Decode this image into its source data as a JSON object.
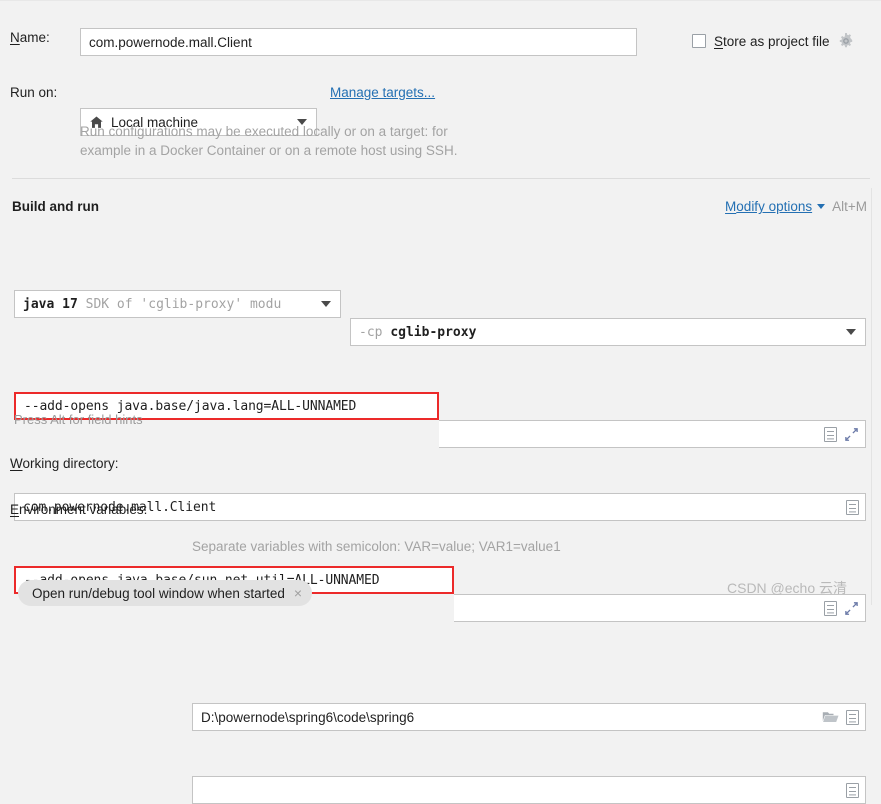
{
  "window": {
    "watermark": "CSDN @echo 云清"
  },
  "name_row": {
    "label": "Name:",
    "mnemonic": "N",
    "label_rest": "ame:",
    "value": "com.powernode.mall.Client",
    "store_as_project_file": {
      "label": "Store as project file",
      "mnemonic": "S",
      "label_rest": "tore as project file",
      "checked": false
    },
    "gear_icon": "gear-icon"
  },
  "run_on": {
    "label": "Run on:",
    "target": "Local machine",
    "target_icon": "home-icon",
    "manage_targets_link": "Manage targets...",
    "description_line1": "Run configurations may be executed locally or on a target: for",
    "description_line2": "example in a Docker Container or on a remote host using SSH."
  },
  "build_and_run": {
    "title": "Build and run",
    "modify_options": {
      "mnemonic": "M",
      "label_rest": "odify options",
      "full_label": "Modify options",
      "shortcut": "Alt+M"
    },
    "jre_combo": {
      "value_bold": "java 17",
      "value_dim": "SDK of 'cglib-proxy' modu"
    },
    "module_combo": {
      "prefix": "-cp",
      "value": "cglib-proxy"
    },
    "vm_options_field": {
      "value": "--add-opens java.base/java.lang=ALL-UNNAMED",
      "highlighted": true,
      "icons": [
        "document-icon",
        "expand-icon"
      ]
    },
    "main_class_field": {
      "value": "com.powernode.mall.Client",
      "icons": [
        "document-icon"
      ]
    },
    "program_args_field": {
      "value": "--add-opens java.base/sun.net.util=ALL-UNNAMED",
      "highlighted": true,
      "icons": [
        "document-icon",
        "expand-icon"
      ]
    },
    "field_hint": "Press Alt for field hints",
    "working_directory": {
      "label": "Working directory:",
      "mnemonic": "W",
      "label_rest": "orking directory:",
      "value": "D:\\powernode\\spring6\\code\\spring6",
      "icons": [
        "folder-icon",
        "document-icon"
      ]
    },
    "environment_variables": {
      "label": "Environment variables:",
      "mnemonic": "E",
      "label_rest": "nvironment variables:",
      "value": "",
      "hint": "Separate variables with semicolon: VAR=value; VAR1=value1",
      "icons": [
        "document-icon"
      ]
    }
  },
  "bottom": {
    "chip_label": "Open run/debug tool window when started",
    "chip_close": "×"
  },
  "colors": {
    "background": "#f2f2f2",
    "field_background": "#ffffff",
    "border": "#c4c4c4",
    "link": "#2470b3",
    "error_outline": "#ec2a2a",
    "muted_text": "#a3a3a3",
    "chip_background": "#e2e2e2"
  }
}
